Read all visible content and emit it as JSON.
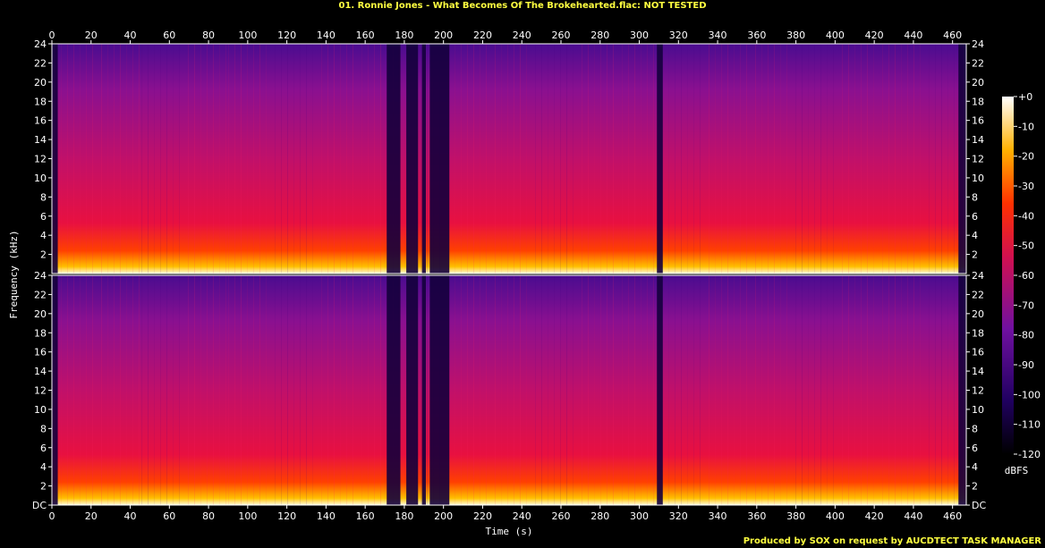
{
  "chart_data": {
    "type": "heatmap",
    "title": "01. Ronnie Jones - What Becomes Of The Brokehearted.flac: NOT TESTED",
    "footer": "Produced by SOX on request by AUCDTECT TASK MANAGER",
    "xlabel": "Time (s)",
    "ylabel": "Frequency (kHz)",
    "colorbar_label": "dBFS",
    "xlim": [
      0,
      467
    ],
    "ylim": [
      0,
      24
    ],
    "x_ticks": [
      0,
      20,
      40,
      60,
      80,
      100,
      120,
      140,
      160,
      180,
      200,
      220,
      240,
      260,
      280,
      300,
      320,
      340,
      360,
      380,
      400,
      420,
      440,
      460
    ],
    "y_tick_labels_top": [
      "24",
      "22",
      "20",
      "18",
      "16",
      "14",
      "12",
      "10",
      "8",
      "6",
      "4",
      "2"
    ],
    "y_tick_labels_bottom": [
      "24",
      "22",
      "20",
      "18",
      "16",
      "14",
      "12",
      "10",
      "8",
      "6",
      "4",
      "2",
      "DC"
    ],
    "colorbar_ticks": [
      "+0",
      "-10",
      "-20",
      "-30",
      "-40",
      "-50",
      "-60",
      "-70",
      "-80",
      "-90",
      "-100",
      "-110",
      "-120"
    ],
    "channels": 2,
    "colors": {
      "background": "#000000",
      "title": "#ffff40",
      "low": "#0a0030",
      "mid_low": "#5a10a0",
      "mid": "#d01060",
      "mid_high": "#ff2000",
      "high": "#ffb000",
      "top": "#ffffe0"
    },
    "quiet_regions_s": [
      [
        0,
        3
      ],
      [
        171,
        178
      ],
      [
        181,
        187
      ],
      [
        189,
        191
      ],
      [
        193,
        203
      ],
      [
        309,
        312
      ],
      [
        463,
        467
      ]
    ]
  }
}
